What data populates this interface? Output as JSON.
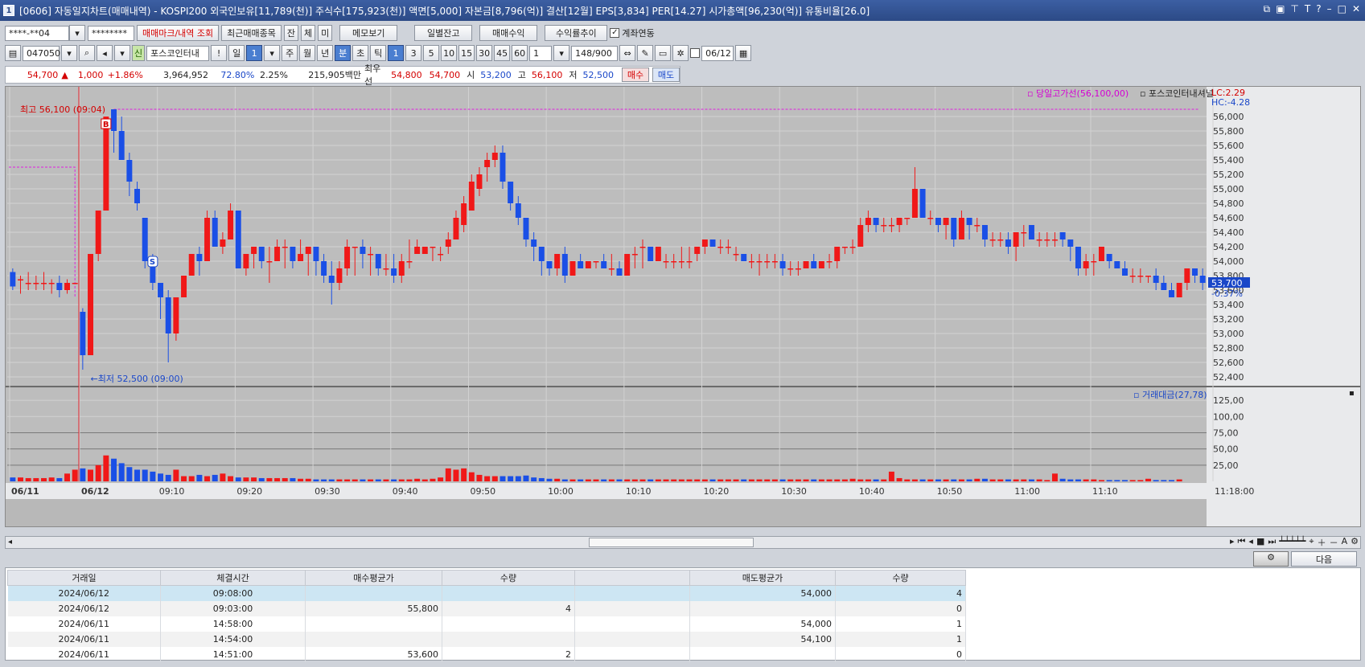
{
  "window": {
    "title": "[0606] 자동일지차트(매매내역) - KOSPI200 외국인보유[11,789(천)] 주식수[175,923(천)] 액면[5,000] 자본금[8,796(억)] 결산[12월] EPS[3,834] PER[14.27] 시가총액[96,230(억)] 유통비율[26.0]",
    "icon_label": "1"
  },
  "toolbar1": {
    "account": "****-**04",
    "password": "********",
    "btn_trade_marks": "매매마크/내역 조회",
    "btn_recent": "최근매매종목",
    "tabs": [
      "잔",
      "체",
      "미"
    ],
    "btn_memo": "메모보기",
    "btn_daily_balance": "일별잔고",
    "btn_trade_profit": "매매수익",
    "btn_return_trend": "수익률추이",
    "account_link_label": "계좌연동"
  },
  "toolbar2": {
    "code": "047050",
    "credit_badge": "신",
    "stock_name": "포스코인터내",
    "period_buttons": [
      "일",
      "1",
      "주",
      "월",
      "년",
      "분",
      "초",
      "틱"
    ],
    "interval_buttons": [
      "1",
      "3",
      "5",
      "10",
      "15",
      "30",
      "45",
      "60"
    ],
    "count_select": "1",
    "bars_count": "148/900",
    "date_value": "06/12"
  },
  "quote": {
    "price": "54,700",
    "change": "1,000",
    "change_pct": "+1.86%",
    "volume": "3,964,952",
    "ratio1": "72.80%",
    "ratio2": "2.25%",
    "amount": "215,905백만",
    "best_ask_label": "최우선",
    "best_ask": "54,800",
    "best_bid": "54,700",
    "open_label": "시",
    "open": "53,200",
    "high_label": "고",
    "high": "56,100",
    "low_label": "저",
    "low": "52,500",
    "buy_btn": "매수",
    "sell_btn": "매도"
  },
  "chart_data": {
    "type": "candlestick",
    "legend_prev_high": "당일고가선(56,100,00)",
    "legend_stock": "포스코인터내셔널",
    "lc_label": "LC:2.29",
    "hc_label": "HC:-4.28",
    "high_annotation": "최고 56,100 (09:04)",
    "low_annotation": "←최저 52,500 (09:00)",
    "buy_marker": "B",
    "sell_marker": "S",
    "current_price_tag": "53,700",
    "current_pct_tag": "-0.37%",
    "price_axis": [
      "56,000",
      "55,800",
      "55,600",
      "55,400",
      "55,200",
      "55,000",
      "54,800",
      "54,600",
      "54,400",
      "54,200",
      "54,000",
      "53,800",
      "53,600",
      "53,400",
      "53,200",
      "53,000",
      "52,800",
      "52,600",
      "52,400"
    ],
    "price_range": [
      52300,
      56300
    ],
    "volume_legend": "거래대금(27,78)",
    "volume_axis": [
      "125,00",
      "100,00",
      "75,00",
      "50,00",
      "25,00"
    ],
    "volume_range": [
      0,
      140
    ],
    "time_axis": [
      "06/11",
      "06/12",
      "09:10",
      "09:20",
      "09:30",
      "09:40",
      "09:50",
      "10:00",
      "10:10",
      "10:20",
      "10:30",
      "10:40",
      "10:50",
      "11:00",
      "11:10",
      "11:18:00"
    ],
    "candles": [
      [
        53850,
        53900,
        53600,
        53650
      ],
      [
        53750,
        53800,
        53550,
        53750
      ],
      [
        53700,
        53850,
        53600,
        53700
      ],
      [
        53700,
        53800,
        53600,
        53700
      ],
      [
        53700,
        53850,
        53600,
        53700
      ],
      [
        53700,
        53750,
        53550,
        53700
      ],
      [
        53700,
        53800,
        53500,
        53600
      ],
      [
        53600,
        53750,
        53550,
        53700
      ],
      [
        53700,
        53700,
        53700,
        53700
      ],
      [
        53300,
        53350,
        52500,
        52700
      ],
      [
        52700,
        54100,
        52700,
        54100
      ],
      [
        54100,
        54700,
        54000,
        54700
      ],
      [
        54700,
        56000,
        54700,
        56000
      ],
      [
        56100,
        56100,
        55500,
        55800
      ],
      [
        55800,
        56000,
        55400,
        55400
      ],
      [
        55400,
        55500,
        54900,
        55100
      ],
      [
        55000,
        55100,
        54700,
        54800
      ],
      [
        54600,
        54600,
        53900,
        54000
      ],
      [
        54000,
        54100,
        53600,
        53700
      ],
      [
        53700,
        53700,
        53200,
        53500
      ],
      [
        53500,
        53600,
        52600,
        53000
      ],
      [
        53000,
        53500,
        52900,
        53500
      ],
      [
        53500,
        53800,
        53500,
        53800
      ],
      [
        53800,
        54100,
        53800,
        54100
      ],
      [
        54100,
        54200,
        53800,
        54000
      ],
      [
        54000,
        54700,
        54000,
        54600
      ],
      [
        54600,
        54700,
        54200,
        54200
      ],
      [
        54200,
        54400,
        54100,
        54300
      ],
      [
        54300,
        54800,
        54300,
        54700
      ],
      [
        54700,
        54700,
        53900,
        53900
      ],
      [
        53900,
        54100,
        53800,
        54100
      ],
      [
        54100,
        54200,
        53900,
        54200
      ],
      [
        54200,
        54200,
        53900,
        54000
      ],
      [
        54000,
        54200,
        53700,
        54000
      ],
      [
        54000,
        54300,
        54000,
        54200
      ],
      [
        54200,
        54300,
        53900,
        54200
      ],
      [
        54200,
        54200,
        53900,
        54000
      ],
      [
        54000,
        54300,
        54000,
        54100
      ],
      [
        54100,
        54200,
        53800,
        54200
      ],
      [
        54200,
        54200,
        53800,
        54000
      ],
      [
        54000,
        54100,
        53700,
        53800
      ],
      [
        53800,
        54000,
        53400,
        53700
      ],
      [
        53700,
        54000,
        53600,
        53900
      ],
      [
        53900,
        54300,
        53800,
        54200
      ],
      [
        54200,
        54200,
        53800,
        54200
      ],
      [
        54200,
        54300,
        53900,
        54100
      ],
      [
        54100,
        54200,
        53800,
        54100
      ],
      [
        54100,
        54100,
        53800,
        53900
      ],
      [
        53900,
        54100,
        53800,
        53900
      ],
      [
        53900,
        54100,
        53700,
        53800
      ],
      [
        53800,
        54100,
        53700,
        54000
      ],
      [
        54000,
        54300,
        53900,
        54000
      ],
      [
        54100,
        54300,
        54100,
        54200
      ],
      [
        54100,
        54200,
        54100,
        54200
      ],
      [
        54200,
        54200,
        54000,
        54200
      ],
      [
        54100,
        54200,
        54000,
        54100
      ],
      [
        54200,
        54400,
        54100,
        54300
      ],
      [
        54300,
        54700,
        54300,
        54600
      ],
      [
        54500,
        54900,
        54400,
        54800
      ],
      [
        54700,
        55200,
        54700,
        55100
      ],
      [
        55000,
        55300,
        54900,
        55200
      ],
      [
        55300,
        55500,
        55100,
        55400
      ],
      [
        55400,
        55600,
        55300,
        55500
      ],
      [
        55500,
        55600,
        55000,
        55100
      ],
      [
        55100,
        55100,
        54700,
        54800
      ],
      [
        54800,
        54900,
        54500,
        54600
      ],
      [
        54600,
        54600,
        54200,
        54300
      ],
      [
        54300,
        54400,
        54000,
        54200
      ],
      [
        54200,
        54200,
        53800,
        54000
      ],
      [
        54000,
        54000,
        53800,
        53900
      ],
      [
        53900,
        54100,
        53800,
        54100
      ],
      [
        54100,
        54200,
        53700,
        53800
      ],
      [
        53800,
        54000,
        53800,
        54000
      ],
      [
        54000,
        54100,
        53900,
        53900
      ],
      [
        53900,
        54000,
        53900,
        54000
      ],
      [
        54000,
        54000,
        53900,
        54000
      ],
      [
        54000,
        54100,
        53900,
        53900
      ],
      [
        53900,
        54100,
        53800,
        53900
      ],
      [
        53900,
        54000,
        53800,
        53800
      ],
      [
        53800,
        54100,
        53800,
        54100
      ],
      [
        54100,
        54200,
        53900,
        54100
      ],
      [
        54200,
        54300,
        53900,
        54200
      ],
      [
        54200,
        54200,
        54000,
        54000
      ],
      [
        54000,
        54200,
        54000,
        54200
      ],
      [
        54000,
        54100,
        53900,
        54000
      ],
      [
        54000,
        54100,
        53900,
        54000
      ],
      [
        54000,
        54200,
        53900,
        54000
      ],
      [
        54000,
        54200,
        53900,
        54000
      ],
      [
        54100,
        54200,
        54000,
        54200
      ],
      [
        54200,
        54300,
        54100,
        54300
      ],
      [
        54300,
        54300,
        54200,
        54200
      ],
      [
        54200,
        54300,
        54100,
        54200
      ],
      [
        54200,
        54300,
        54100,
        54200
      ],
      [
        54100,
        54200,
        54000,
        54100
      ],
      [
        54100,
        54100,
        54000,
        54000
      ],
      [
        54000,
        54100,
        53900,
        54000
      ],
      [
        54000,
        54100,
        53800,
        54000
      ],
      [
        54000,
        54100,
        53900,
        54000
      ],
      [
        54000,
        54100,
        53900,
        54000
      ],
      [
        54000,
        54100,
        53800,
        53900
      ],
      [
        53900,
        54000,
        53800,
        53900
      ],
      [
        53900,
        54000,
        53800,
        53900
      ],
      [
        53900,
        54000,
        53900,
        54000
      ],
      [
        54000,
        54100,
        53900,
        53900
      ],
      [
        53900,
        54000,
        53900,
        54000
      ],
      [
        54000,
        54100,
        53900,
        54000
      ],
      [
        54000,
        54200,
        53900,
        54200
      ],
      [
        54200,
        54200,
        54100,
        54200
      ],
      [
        54200,
        54300,
        54100,
        54200
      ],
      [
        54200,
        54600,
        54200,
        54500
      ],
      [
        54500,
        54700,
        54400,
        54600
      ],
      [
        54600,
        54600,
        54400,
        54500
      ],
      [
        54500,
        54600,
        54400,
        54500
      ],
      [
        54500,
        54600,
        54400,
        54500
      ],
      [
        54500,
        54600,
        54400,
        54600
      ],
      [
        54600,
        54600,
        54500,
        54600
      ],
      [
        54600,
        55300,
        54600,
        55000
      ],
      [
        55000,
        55000,
        54600,
        54600
      ],
      [
        54600,
        54700,
        54500,
        54600
      ],
      [
        54600,
        54600,
        54400,
        54500
      ],
      [
        54500,
        54600,
        54300,
        54600
      ],
      [
        54600,
        54600,
        54200,
        54300
      ],
      [
        54300,
        54700,
        54300,
        54600
      ],
      [
        54600,
        54600,
        54300,
        54500
      ],
      [
        54500,
        54600,
        54400,
        54500
      ],
      [
        54500,
        54500,
        54200,
        54300
      ],
      [
        54300,
        54400,
        54200,
        54300
      ],
      [
        54300,
        54400,
        54200,
        54300
      ],
      [
        54300,
        54400,
        54100,
        54200
      ],
      [
        54200,
        54400,
        54000,
        54400
      ],
      [
        54400,
        54500,
        54200,
        54400
      ],
      [
        54500,
        54500,
        54300,
        54300
      ],
      [
        54300,
        54400,
        54200,
        54300
      ],
      [
        54300,
        54400,
        54200,
        54300
      ],
      [
        54300,
        54400,
        54200,
        54300
      ],
      [
        54400,
        54400,
        54200,
        54300
      ],
      [
        54300,
        54300,
        54000,
        54200
      ],
      [
        54200,
        54200,
        53800,
        53900
      ],
      [
        53900,
        54100,
        53800,
        54000
      ],
      [
        54000,
        54100,
        53800,
        54000
      ],
      [
        54000,
        54200,
        54000,
        54200
      ],
      [
        54100,
        54100,
        53900,
        54000
      ],
      [
        54000,
        54000,
        53900,
        53900
      ],
      [
        53900,
        54000,
        53800,
        53800
      ],
      [
        53800,
        53900,
        53700,
        53800
      ],
      [
        53800,
        53900,
        53700,
        53800
      ],
      [
        53800,
        53800,
        53700,
        53800
      ],
      [
        53800,
        53900,
        53600,
        53700
      ],
      [
        53700,
        53800,
        53600,
        53600
      ],
      [
        53600,
        53700,
        53500,
        53500
      ],
      [
        53500,
        53700,
        53500,
        53700
      ],
      [
        53700,
        53900,
        53600,
        53900
      ],
      [
        53900,
        53900,
        53700,
        53800
      ],
      [
        53800,
        53900,
        53600,
        53700
      ]
    ],
    "volumes": [
      6,
      6,
      5,
      5,
      5,
      6,
      5,
      12,
      18,
      20,
      18,
      25,
      40,
      35,
      28,
      22,
      18,
      18,
      15,
      12,
      10,
      18,
      8,
      8,
      10,
      8,
      10,
      12,
      8,
      6,
      6,
      6,
      5,
      5,
      5,
      5,
      5,
      4,
      4,
      3,
      3,
      3,
      3,
      3,
      3,
      3,
      3,
      3,
      3,
      3,
      3,
      3,
      4,
      3,
      4,
      6,
      20,
      18,
      20,
      14,
      10,
      8,
      8,
      8,
      8,
      8,
      9,
      6,
      5,
      4,
      4,
      3,
      3,
      3,
      3,
      3,
      3,
      3,
      3,
      3,
      3,
      3,
      3,
      3,
      3,
      3,
      3,
      3,
      3,
      3,
      3,
      3,
      3,
      3,
      3,
      3,
      3,
      3,
      3,
      3,
      3,
      3,
      3,
      3,
      3,
      3,
      3,
      3,
      4,
      3,
      3,
      3,
      3,
      15,
      5,
      3,
      3,
      3,
      3,
      3,
      3,
      3,
      3,
      3,
      4,
      4,
      3,
      3,
      3,
      3,
      3,
      3,
      3,
      2,
      12,
      4,
      3,
      3,
      3,
      3,
      2,
      2,
      2,
      2,
      2,
      2,
      4,
      2,
      2,
      2,
      3
    ]
  },
  "table": {
    "columns": [
      "거래일",
      "체결시간",
      "매수평균가",
      "수량",
      "",
      "매도평균가",
      "수량"
    ],
    "rows": [
      [
        "2024/06/12",
        "09:08:00",
        "",
        "",
        "",
        "54,000",
        "4"
      ],
      [
        "2024/06/12",
        "09:03:00",
        "55,800",
        "4",
        "",
        "",
        "0"
      ],
      [
        "2024/06/11",
        "14:58:00",
        "",
        "",
        "",
        "54,000",
        "1"
      ],
      [
        "2024/06/11",
        "14:54:00",
        "",
        "",
        "",
        "54,100",
        "1"
      ],
      [
        "2024/06/11",
        "14:51:00",
        "53,600",
        "2",
        "",
        "",
        "0"
      ]
    ],
    "next_btn": "다음"
  }
}
